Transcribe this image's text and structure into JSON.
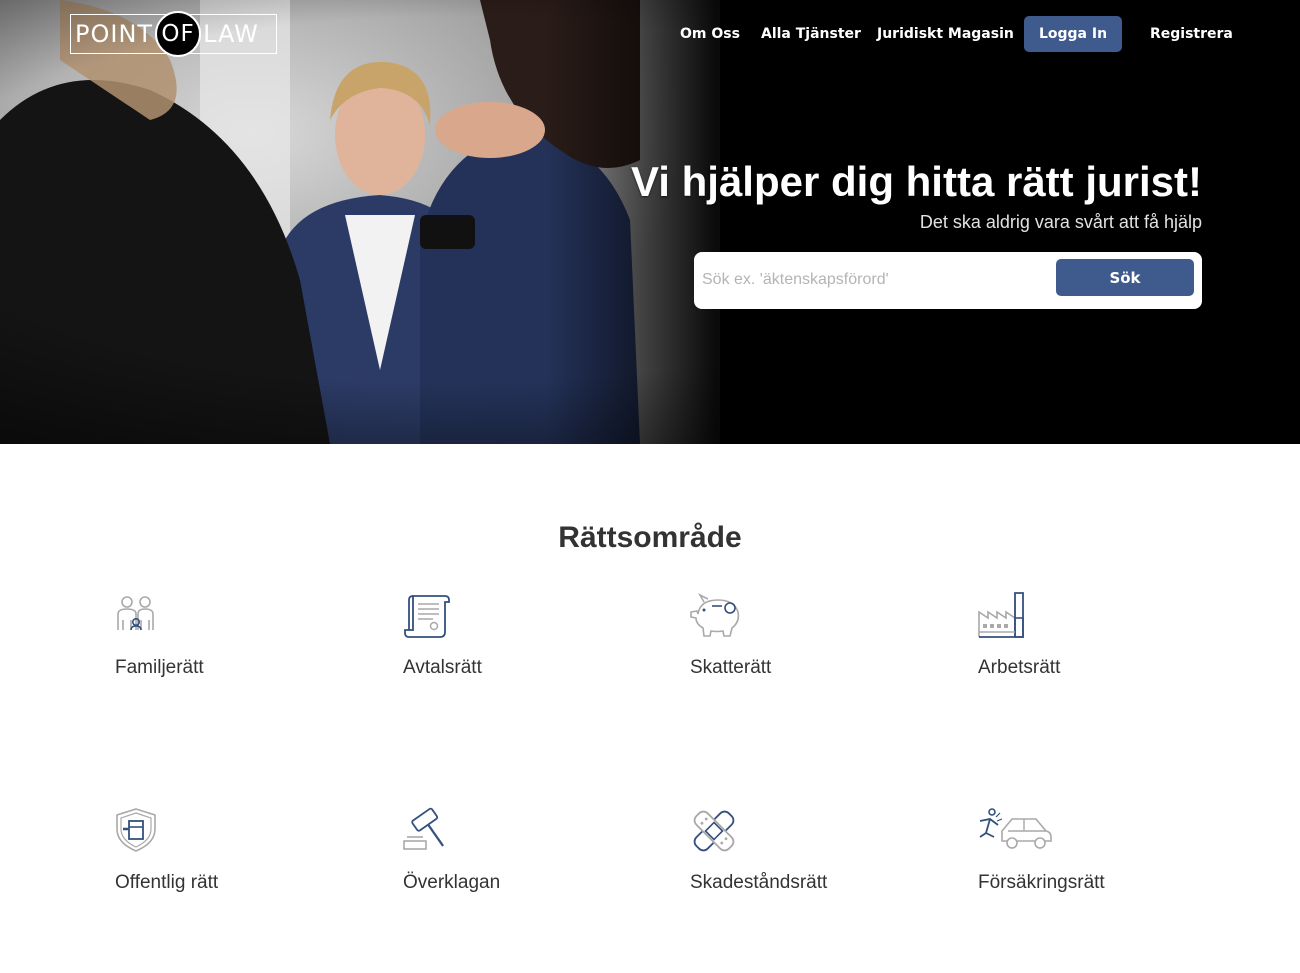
{
  "brand": {
    "logo_left": "POINT",
    "logo_mid": "OF",
    "logo_right": "LAW"
  },
  "nav": {
    "about": "Om Oss",
    "all_services": "Alla Tjänster",
    "magazine": "Juridiskt Magasin",
    "login": "Logga In",
    "register": "Registrera"
  },
  "hero": {
    "title": "Vi hjälper dig hitta rätt jurist!",
    "subtitle": "Det ska aldrig vara svårt att få hjälp",
    "search_placeholder": "Sök ex. 'äktenskapsförord'",
    "search_value": "",
    "search_button": "Sök"
  },
  "areas": {
    "title": "Rättsområde",
    "items": [
      {
        "label": "Familjerätt",
        "icon": "family-icon"
      },
      {
        "label": "Avtalsrätt",
        "icon": "contract-scroll-icon"
      },
      {
        "label": "Skatterätt",
        "icon": "piggy-bank-icon"
      },
      {
        "label": "Arbetsrätt",
        "icon": "factory-icon"
      },
      {
        "label": "Offentlig rätt",
        "icon": "shield-icon"
      },
      {
        "label": "Överklagan",
        "icon": "gavel-icon"
      },
      {
        "label": "Skadeståndsrätt",
        "icon": "bandage-icon"
      },
      {
        "label": "Försäkringsrätt",
        "icon": "car-accident-icon"
      }
    ]
  },
  "colors": {
    "accent": "#3f5a8c",
    "icon_blue": "#34507d",
    "icon_grey": "#a9a9a9",
    "text_dark": "#333333"
  }
}
